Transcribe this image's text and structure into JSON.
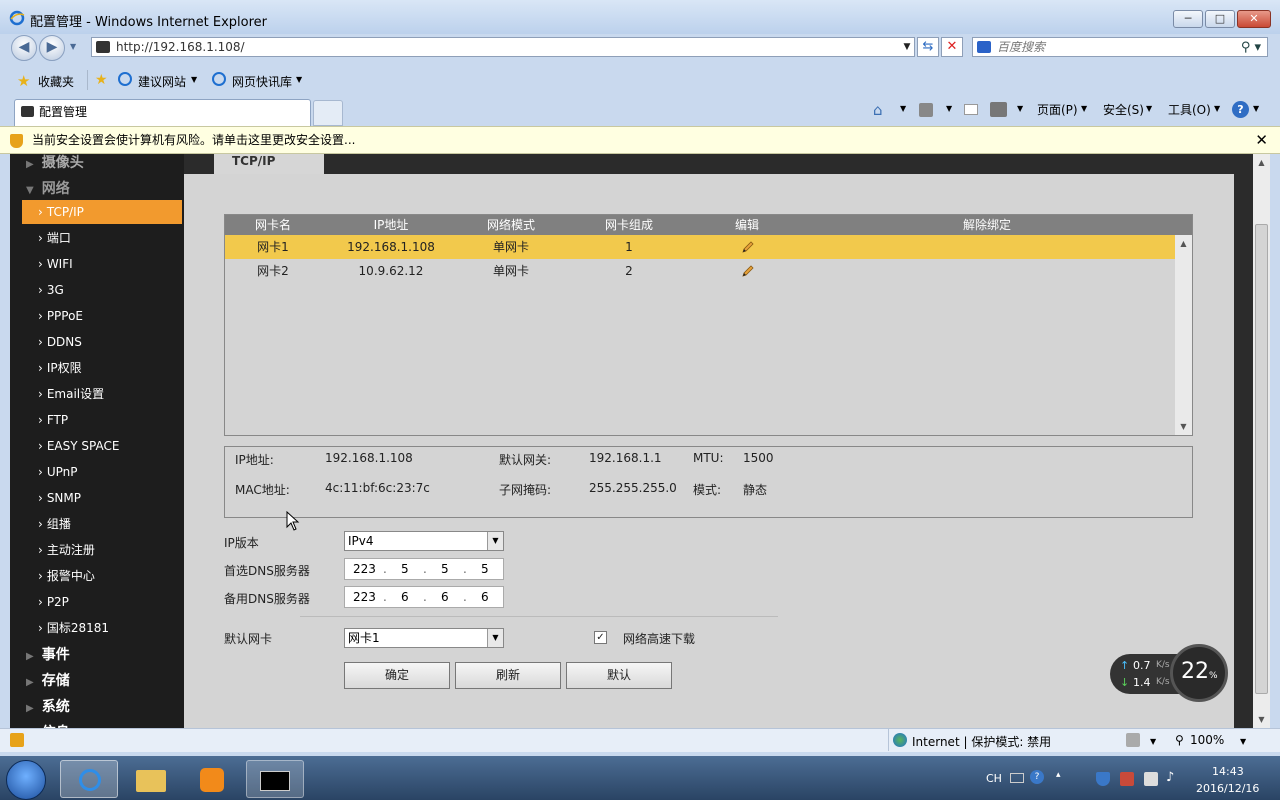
{
  "window": {
    "title": "配置管理 - Windows Internet Explorer",
    "minimize": "─",
    "maximize": "□",
    "close": "✕"
  },
  "nav": {
    "back": "◀",
    "forward": "▶",
    "address": "http://192.168.1.108/",
    "search_placeholder": "百度搜索"
  },
  "favbar": {
    "favorites": "收藏夹",
    "suggested": "建议网站",
    "webslice": "网页快讯库"
  },
  "tabs": {
    "active": "配置管理"
  },
  "commandbar": {
    "page": "页面(P)",
    "safety": "安全(S)",
    "tools": "工具(O)"
  },
  "infobar": {
    "message": "当前安全设置会使计算机有风险。请单击这里更改安全设置..."
  },
  "sidebar": {
    "top_cut": "摄像头",
    "network": "网络",
    "items": [
      {
        "label": "TCP/IP",
        "active": true
      },
      {
        "label": "端口"
      },
      {
        "label": "WIFI"
      },
      {
        "label": "3G"
      },
      {
        "label": "PPPoE"
      },
      {
        "label": "DDNS"
      },
      {
        "label": "IP权限"
      },
      {
        "label": "Email设置"
      },
      {
        "label": "FTP"
      },
      {
        "label": "EASY SPACE"
      },
      {
        "label": "UPnP"
      },
      {
        "label": "SNMP"
      },
      {
        "label": "组播"
      },
      {
        "label": "主动注册"
      },
      {
        "label": "报警中心"
      },
      {
        "label": "P2P"
      },
      {
        "label": "国标28181"
      }
    ],
    "events": "事件",
    "storage": "存储",
    "system": "系统",
    "bottom_cut": "信息"
  },
  "main": {
    "tab_title": "TCP/IP",
    "table": {
      "headers": [
        "网卡名",
        "IP地址",
        "网络模式",
        "网卡组成",
        "编辑",
        "解除绑定"
      ],
      "rows": [
        {
          "name": "网卡1",
          "ip": "192.168.1.108",
          "mode": "单网卡",
          "group": "1",
          "selected": true
        },
        {
          "name": "网卡2",
          "ip": "10.9.62.12",
          "mode": "单网卡",
          "group": "2",
          "selected": false
        }
      ]
    },
    "details": {
      "ip_label": "IP地址:",
      "ip_value": "192.168.1.108",
      "gateway_label": "默认网关:",
      "gateway_value": "192.168.1.1",
      "mtu_label": "MTU:",
      "mtu_value": "1500",
      "mac_label": "MAC地址:",
      "mac_value": "4c:11:bf:6c:23:7c",
      "mask_label": "子网掩码:",
      "mask_value": "255.255.255.0",
      "mode_label": "模式:",
      "mode_value": "静态"
    },
    "form": {
      "ip_version_label": "IP版本",
      "ip_version_value": "IPv4",
      "dns1_label": "首选DNS服务器",
      "dns1": [
        "223",
        "5",
        "5",
        "5"
      ],
      "dns2_label": "备用DNS服务器",
      "dns2": [
        "223",
        "6",
        "6",
        "6"
      ],
      "default_nic_label": "默认网卡",
      "default_nic_value": "网卡1",
      "fast_download_label": "网络高速下载",
      "fast_download_checked": true
    },
    "buttons": {
      "ok": "确定",
      "refresh": "刷新",
      "default": "默认"
    }
  },
  "speed_widget": {
    "up": "0.7",
    "down": "1.4",
    "unit": "K/s",
    "percent": "22",
    "percent_sign": "%"
  },
  "statusbar": {
    "zone": "Internet | 保护模式: 禁用",
    "zoom": "100%"
  },
  "taskbar": {
    "lang": "CH",
    "time": "14:43",
    "date": "2016/12/16"
  }
}
